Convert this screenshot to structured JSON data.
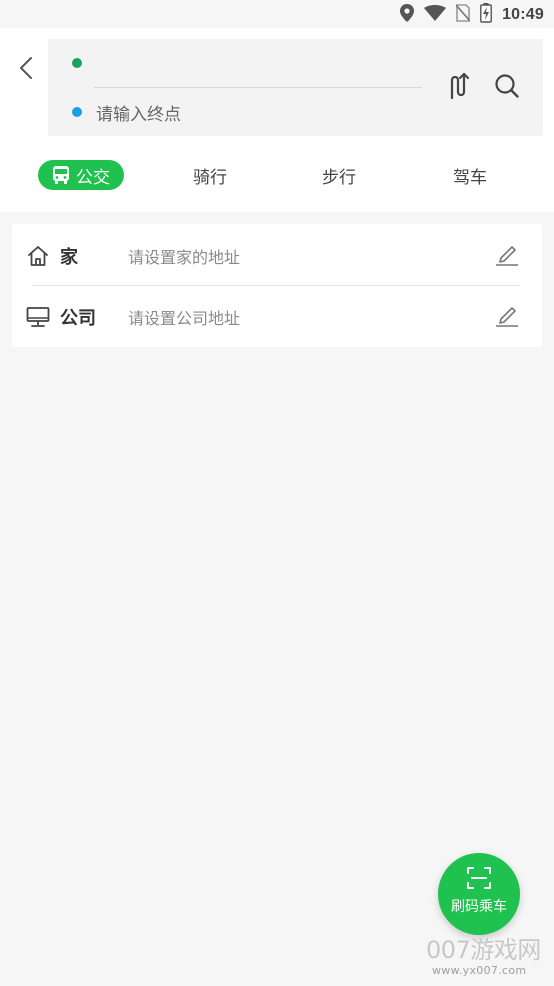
{
  "status_bar": {
    "time": "10:49",
    "icons": [
      "location-icon",
      "wifi-icon",
      "no-sim-icon",
      "battery-icon"
    ]
  },
  "header": {
    "back_icon": "back-arrow-icon",
    "start_input": {
      "value": "",
      "placeholder": ""
    },
    "end_input": {
      "value": "",
      "placeholder": "请输入终点"
    },
    "swap_icon": "swap-route-icon",
    "search_icon": "search-icon",
    "start_dot_color": "#1aa260",
    "end_dot_color": "#1a9ee6"
  },
  "modes": {
    "active_color": "#1fc24e",
    "items": [
      {
        "label": "公交",
        "icon": "bus-icon",
        "active": true
      },
      {
        "label": "骑行",
        "active": false
      },
      {
        "label": "步行",
        "active": false
      },
      {
        "label": "驾车",
        "active": false
      }
    ]
  },
  "shortcuts": {
    "home": {
      "icon": "home-icon",
      "title": "家",
      "hint": "请设置家的地址",
      "edit_icon": "edit-icon"
    },
    "company": {
      "icon": "monitor-icon",
      "title": "公司",
      "hint": "请设置公司地址",
      "edit_icon": "edit-icon"
    }
  },
  "fab": {
    "label": "刷码乘车",
    "icon": "scan-icon",
    "color": "#1fc24e"
  },
  "watermark": {
    "main": "007游戏网",
    "sub": "www.yx007.com"
  }
}
